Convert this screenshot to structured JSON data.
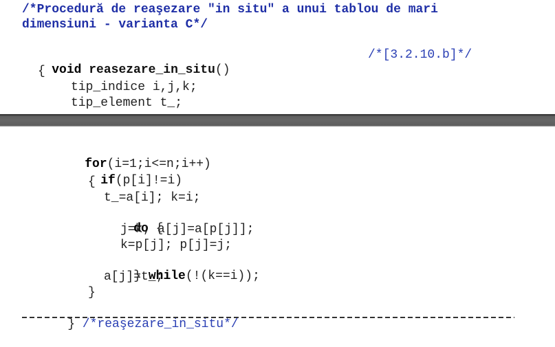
{
  "top": {
    "header_line1": "/*Procedură de reaşezare \"in situ\" a unui tablou de mari",
    "header_line2": "dimensiuni - varianta C*/",
    "sig_void": "void",
    "sig_name": "reasezare_in_situ",
    "sig_parens": "()",
    "sig_comment": "/*[3.2.10.b]*/",
    "brace_open": "{",
    "decl1": "tip_indice i,j,k;",
    "decl2": "tip_element t_;"
  },
  "bottom": {
    "for_kw": "for",
    "for_rest": "(i=1;i<=n;i++)",
    "if_kw": "if",
    "if_rest": "(p[i]!=i)",
    "brace1_open": "{",
    "stmt1": "t_=a[i]; k=i;",
    "do_kw": "do",
    "do_brace": "{",
    "stmt2": "j=k; a[j]=a[p[j]];",
    "stmt3": "k=p[j]; p[j]=j;",
    "close_brace": "}",
    "while_kw": "while",
    "while_rest": "(!(k==i));",
    "stmt4": "a[j]=t_;",
    "brace1_close": "}",
    "end_brace": "}",
    "end_comment": "/*reaşezare_in_situ*/"
  }
}
